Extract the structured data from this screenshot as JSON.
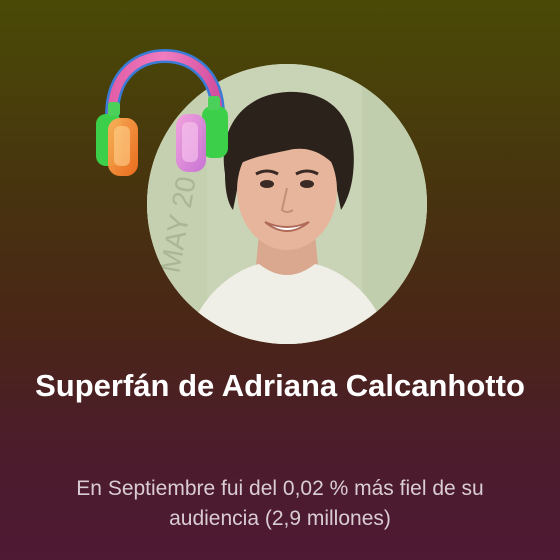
{
  "card": {
    "title": "Superfán de Adriana Calcanhotto",
    "subtitle": "En Septiembre fui del 0,02 % más fiel de su audiencia (2,9 millones)"
  },
  "images": {
    "portrait": "artist-portrait",
    "badge": "headphones-icon"
  },
  "colors": {
    "background_top": "#4a4a06",
    "background_bottom": "#4e1a34",
    "title_text": "#ffffff",
    "subtitle_text": "#d9cdd2"
  }
}
